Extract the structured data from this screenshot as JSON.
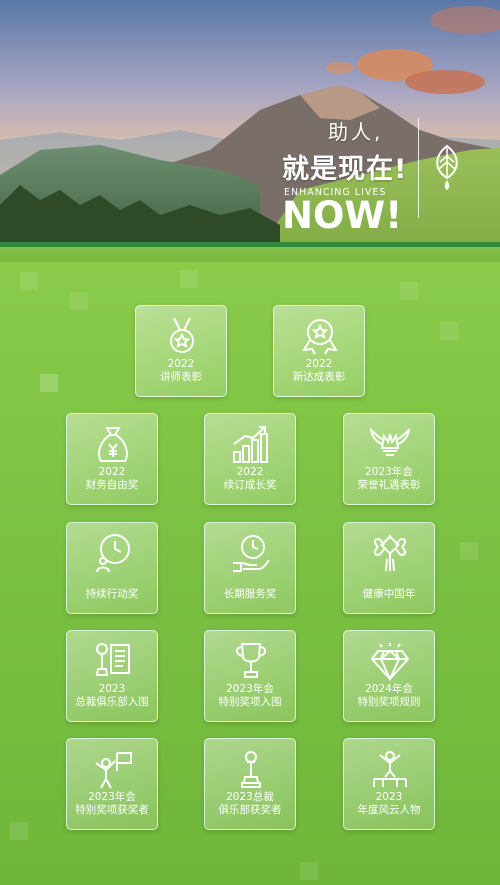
{
  "hero": {
    "slogan_top": "助人,",
    "slogan_main": "就是现在!",
    "slogan_en": "ENHANCING LIVES",
    "slogan_now": "NOW!"
  },
  "menu": [
    {
      "line1": "2022",
      "line2": "讲师表彰",
      "icon": "medal-icon"
    },
    {
      "line1": "2022",
      "line2": "新达成表彰",
      "icon": "badge-ribbon-icon"
    },
    {
      "line1": "2022",
      "line2": "财务自由奖",
      "icon": "money-bag-icon"
    },
    {
      "line1": "2022",
      "line2": "续订成长奖",
      "icon": "growth-chart-icon"
    },
    {
      "line1": "2023年会",
      "line2": "荣誉礼遇表彰",
      "icon": "winged-crown-icon"
    },
    {
      "line1": "",
      "line2": "持续行动奖",
      "icon": "person-clock-icon"
    },
    {
      "line1": "",
      "line2": "长期服务奖",
      "icon": "hand-clock-icon"
    },
    {
      "line1": "",
      "line2": "健康中国年",
      "icon": "chinese-knot-icon"
    },
    {
      "line1": "2023",
      "line2": "总裁俱乐部入围",
      "icon": "trophy-document-icon"
    },
    {
      "line1": "2023年会",
      "line2": "特别奖项入围",
      "icon": "cup-icon"
    },
    {
      "line1": "2024年会",
      "line2": "特别奖项规则",
      "icon": "diamond-icon"
    },
    {
      "line1": "2023年会",
      "line2": "特别奖项获奖者",
      "icon": "flag-person-icon"
    },
    {
      "line1": "2023总裁",
      "line2": "俱乐部获奖者",
      "icon": "torch-trophy-icon"
    },
    {
      "line1": "2023",
      "line2": "年度风云人物",
      "icon": "winner-podium-icon"
    }
  ]
}
